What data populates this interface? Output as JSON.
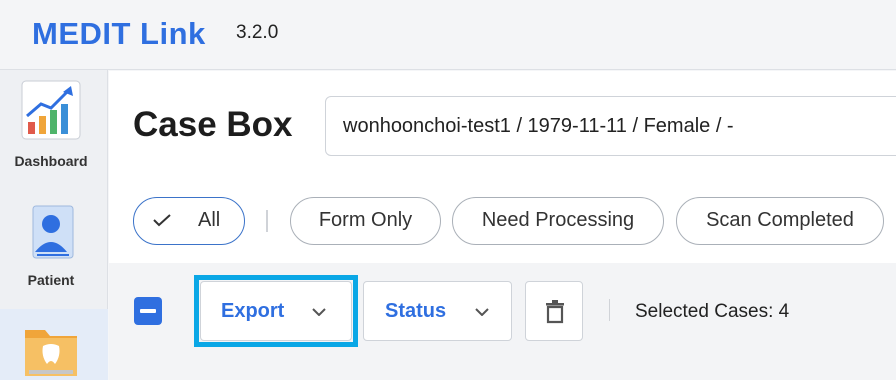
{
  "app": {
    "name": "MEDIT Link",
    "version": "3.2.0"
  },
  "sidebar": {
    "items": [
      {
        "label": "Dashboard",
        "icon": "dashboard-chart-icon"
      },
      {
        "label": "Patient",
        "icon": "patient-icon"
      },
      {
        "label": "",
        "icon": "case-box-folder-icon",
        "active": true
      }
    ]
  },
  "main": {
    "title": "Case Box",
    "patient_info": "wonhoonchoi-test1 / 1979-11-11 / Female / -"
  },
  "filters": {
    "items": [
      "All",
      "Form Only",
      "Need Processing",
      "Scan Completed"
    ],
    "selected": "All"
  },
  "toolbar": {
    "export_label": "Export",
    "status_label": "Status",
    "selected_cases": "Selected Cases: 4"
  },
  "colors": {
    "brand": "#2f6fe0",
    "highlight": "#0aa7e6"
  }
}
